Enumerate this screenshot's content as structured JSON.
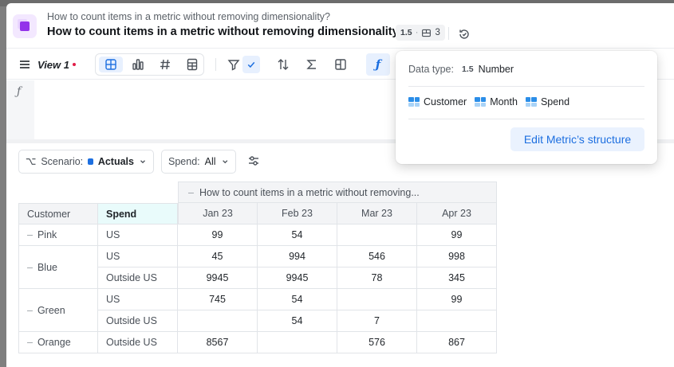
{
  "header": {
    "breadcrumb": "How to count items in a metric without removing dimensionality?",
    "title": "How to count items in a metric without removing dimensionality?",
    "type_badge": "1.5",
    "dimension_count": "3"
  },
  "toolbar": {
    "view_label": "View 1"
  },
  "filters": {
    "scenario_label": "Scenario:",
    "scenario_value": "Actuals",
    "spend_label": "Spend:",
    "spend_value": "All"
  },
  "table": {
    "group_header": "How to count items in a metric without removing...",
    "group_dash": "–",
    "headers": {
      "customer": "Customer",
      "spend": "Spend"
    },
    "months": [
      "Jan 23",
      "Feb 23",
      "Mar 23",
      "Apr 23"
    ],
    "customers": [
      {
        "name": "Pink",
        "rows": [
          {
            "spend": "US",
            "values": [
              "99",
              "54",
              "",
              "99"
            ]
          }
        ]
      },
      {
        "name": "Blue",
        "rows": [
          {
            "spend": "US",
            "values": [
              "45",
              "994",
              "546",
              "998"
            ]
          },
          {
            "spend": "Outside US",
            "values": [
              "9945",
              "9945",
              "78",
              "345"
            ]
          }
        ]
      },
      {
        "name": "Green",
        "rows": [
          {
            "spend": "US",
            "values": [
              "745",
              "54",
              "",
              "99"
            ]
          },
          {
            "spend": "Outside US",
            "values": [
              "",
              "54",
              "7",
              ""
            ]
          }
        ]
      },
      {
        "name": "Orange",
        "rows": [
          {
            "spend": "Outside US",
            "values": [
              "8567",
              "",
              "576",
              "867"
            ]
          }
        ]
      }
    ]
  },
  "popover": {
    "data_type_label": "Data type:",
    "data_type_badge": "1.5",
    "data_type_value": "Number",
    "dimensions": [
      "Customer",
      "Month",
      "Spend"
    ],
    "edit_button": "Edit Metric’s structure"
  },
  "colors": {
    "accent": "#1d6fe0",
    "spend_header_bg": "#e9fbfb",
    "app_icon": "#9333ea"
  }
}
